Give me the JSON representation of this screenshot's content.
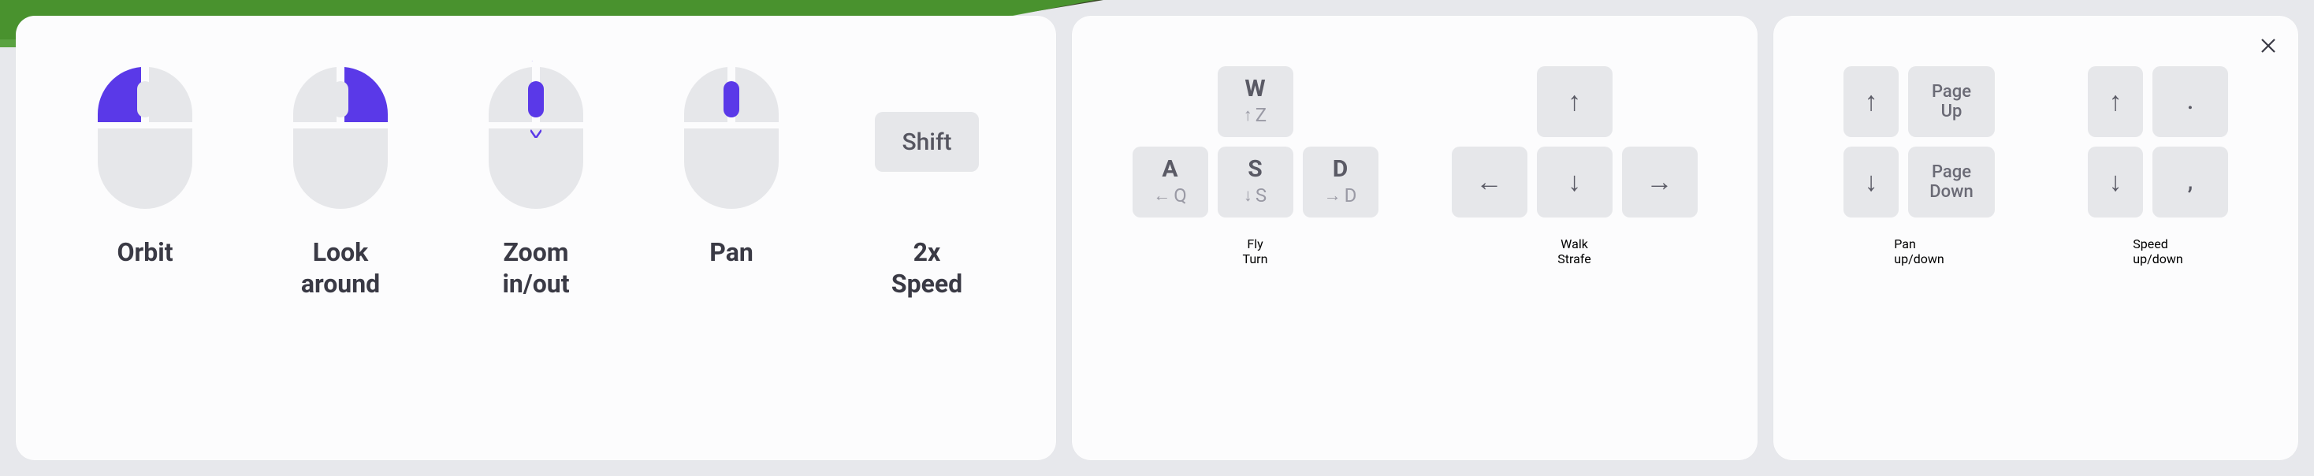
{
  "mouse_panel": {
    "items": [
      {
        "label": "Orbit"
      },
      {
        "label": "Look\naround"
      },
      {
        "label": "Zoom\nin/out"
      },
      {
        "label": "Pan"
      },
      {
        "label": "2x\nSpeed",
        "key": "Shift"
      }
    ]
  },
  "keyboard_panel": {
    "fly": {
      "label": "Fly",
      "sublabel": "Turn",
      "keys": {
        "w": {
          "big": "W",
          "arrow": "↑",
          "alt": "Z"
        },
        "a": {
          "big": "A",
          "arrow": "←",
          "alt": "Q"
        },
        "s": {
          "big": "S",
          "arrow": "↓",
          "alt": "S"
        },
        "d": {
          "big": "D",
          "arrow": "→",
          "alt": "D"
        }
      }
    },
    "walk": {
      "label": "Walk",
      "sublabel": "Strafe",
      "keys": {
        "up": "↑",
        "left": "←",
        "down": "↓",
        "right": "→"
      }
    }
  },
  "extra_panel": {
    "pan": {
      "label": "Pan\nup/down",
      "keys": {
        "up": "↑",
        "down": "↓",
        "pgup": "Page\nUp",
        "pgdn": "Page\nDown"
      }
    },
    "speed": {
      "label": "Speed\nup/down",
      "keys": {
        "up": "↑",
        "down": "↓",
        "dot": ".",
        "comma": ","
      }
    }
  }
}
